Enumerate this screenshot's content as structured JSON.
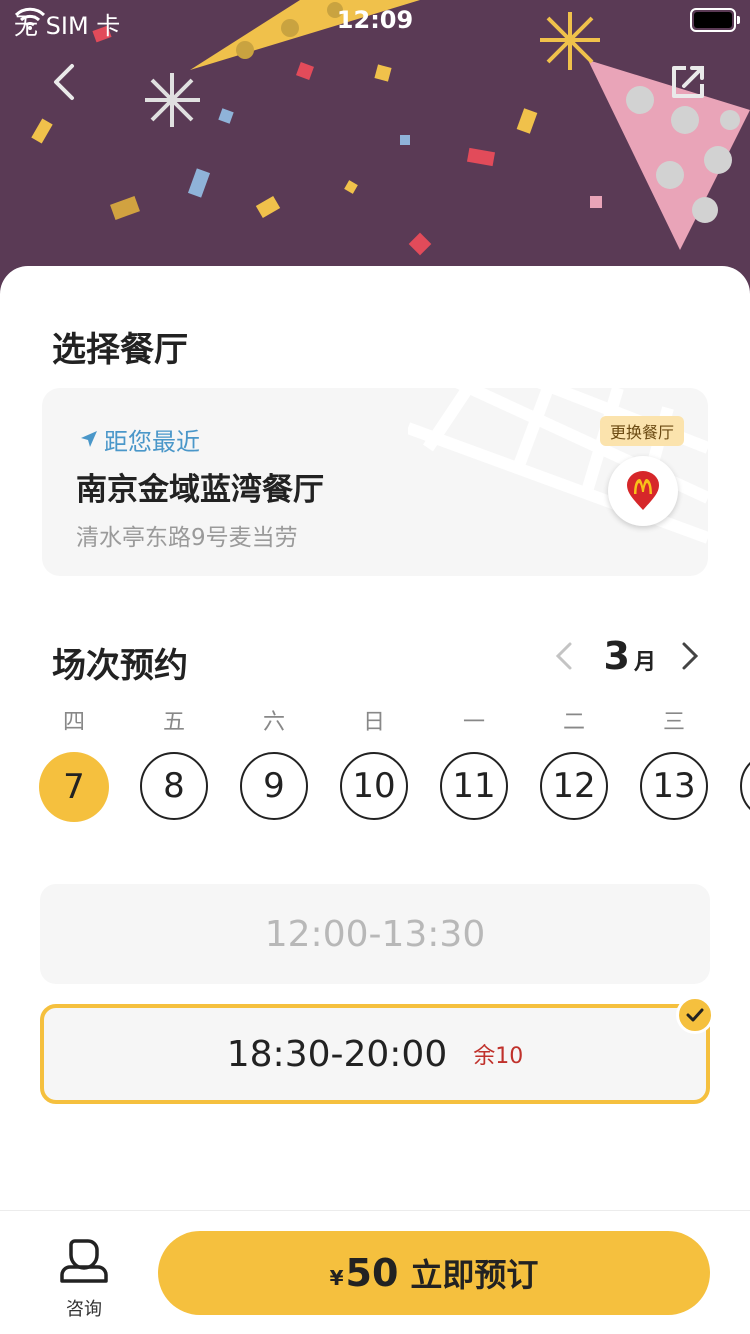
{
  "status_bar": {
    "carrier": "无 SIM 卡",
    "time": "12:09"
  },
  "colors": {
    "accent": "#f5c03e",
    "banner": "#5a3a55",
    "link": "#4a97c9",
    "remaining": "#c0312b"
  },
  "restaurant_section": {
    "title": "选择餐厅",
    "nearest_label": "距您最近",
    "name": "南京金域蓝湾餐厅",
    "address": "清水亭东路9号麦当劳",
    "change_label": "更换餐厅"
  },
  "session_section": {
    "title": "场次预约",
    "month_number": "3",
    "month_unit": "月",
    "days": [
      {
        "weekday": "四",
        "date": "7",
        "selected": true
      },
      {
        "weekday": "五",
        "date": "8"
      },
      {
        "weekday": "六",
        "date": "9"
      },
      {
        "weekday": "日",
        "date": "10"
      },
      {
        "weekday": "一",
        "date": "11"
      },
      {
        "weekday": "二",
        "date": "12"
      },
      {
        "weekday": "三",
        "date": "13"
      },
      {
        "weekday": "",
        "date": ""
      }
    ],
    "slots": [
      {
        "time": "12:00-13:30",
        "state": "disabled"
      },
      {
        "time": "18:30-20:00",
        "remaining": "余10",
        "state": "selected"
      }
    ]
  },
  "bottom_bar": {
    "consult_label": "咨询",
    "currency": "¥",
    "price": "50",
    "book_label": "立即预订"
  },
  "icons": {
    "status_wifi": "wifi-icon",
    "battery": "battery-icon",
    "back": "back-chevron-icon",
    "share": "share-icon",
    "location": "location-arrow-icon",
    "logo": "mcdonalds-pin-icon",
    "prev": "chevron-left-icon",
    "next": "chevron-right-icon",
    "check": "check-icon",
    "consult": "person-icon"
  }
}
